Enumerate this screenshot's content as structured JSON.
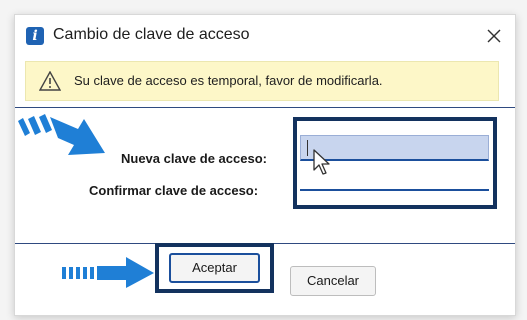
{
  "dialog": {
    "title": "Cambio de clave de acceso",
    "icon": "info-app-icon",
    "app_icon_glyph": "i",
    "close_glyph": "✕"
  },
  "warning": {
    "icon": "warning-triangle-icon",
    "text": "Su clave de acceso es temporal, favor de modificarla."
  },
  "form": {
    "new_password_label": "Nueva clave de acceso:",
    "confirm_password_label": "Confirmar clave de acceso:",
    "new_password_value": "",
    "confirm_password_value": ""
  },
  "buttons": {
    "accept_label": "Aceptar",
    "cancel_label": "Cancelar"
  },
  "colors": {
    "highlight_frame": "#13325e",
    "arrow": "#1f7fd6",
    "input_focus": "#c8d5ee",
    "warning_bg": "#fdf7c8"
  }
}
